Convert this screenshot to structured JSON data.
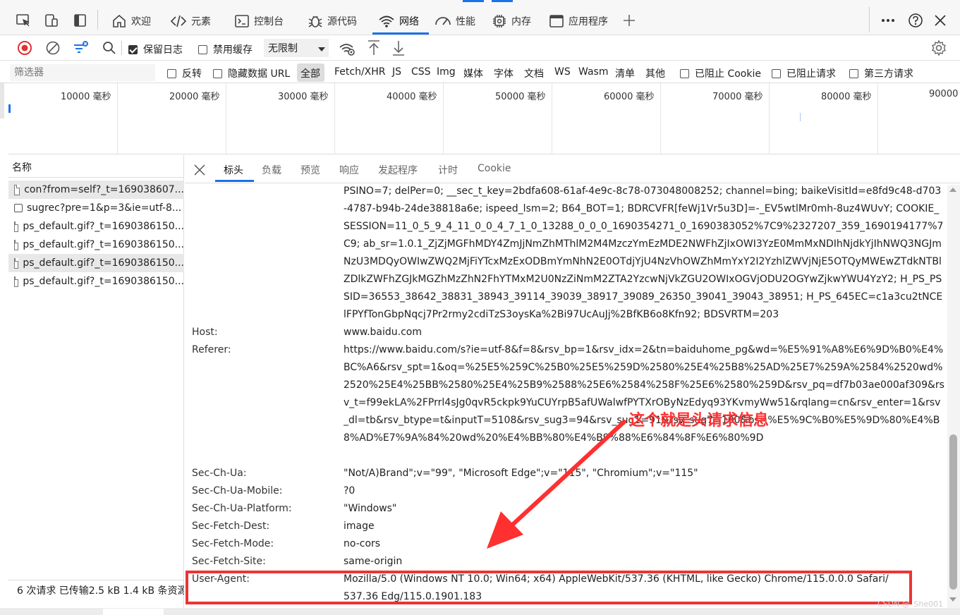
{
  "main_tabs": [
    {
      "label": "欢迎",
      "icon": "home-icon"
    },
    {
      "label": "元素",
      "icon": "code-icon"
    },
    {
      "label": "控制台",
      "icon": "console-icon"
    },
    {
      "label": "源代码",
      "icon": "bug-icon"
    },
    {
      "label": "网络",
      "icon": "wifi-icon",
      "active": true
    },
    {
      "label": "性能",
      "icon": "gauge-icon"
    },
    {
      "label": "内存",
      "icon": "chip-icon"
    },
    {
      "label": "应用程序",
      "icon": "window-icon"
    }
  ],
  "toolbar": {
    "preserve_log": "保留日志",
    "disable_cache": "禁用缓存",
    "throttle": "无限制"
  },
  "filter": {
    "placeholder": "筛选器",
    "invert": "反转",
    "hide_data_urls": "隐藏数据 URL",
    "types": [
      "全部",
      "Fetch/XHR",
      "JS",
      "CSS",
      "Img",
      "媒体",
      "字体",
      "文档",
      "WS",
      "Wasm",
      "清单",
      "其他"
    ],
    "blocked_cookies": "已阻止 Cookie",
    "blocked_requests": "已阻止请求",
    "third_party": "第三方请求"
  },
  "timeline": {
    "ticks": [
      "10000 毫秒",
      "20000 毫秒",
      "30000 毫秒",
      "40000 毫秒",
      "50000 毫秒",
      "60000 毫秒",
      "70000 毫秒",
      "80000 毫秒",
      "90000"
    ]
  },
  "requests": {
    "header": "名称",
    "items": [
      "con?from=self?_t=169038607...",
      "sugrec?pre=1&p=3&ie=utf-8...",
      "ps_default.gif?_t=1690386150...",
      "ps_default.gif?_t=1690386150...",
      "ps_default.gif?_t=1690386150...",
      "ps_default.gif?_t=1690386150..."
    ],
    "status": "6 次请求  已传输2.5 kB  1.4 kB 条资源"
  },
  "detail_tabs": [
    "标头",
    "负载",
    "预览",
    "响应",
    "发起程序",
    "计时",
    "Cookie"
  ],
  "headers": {
    "cookie_cont": "PSINO=7; delPer=0; __sec_t_key=2bdfa608-61af-4e9c-8c78-073048008252; channel=bing; baikeVisitId=e8fd9c48-d703-4787-b94b-24de38818a6e; ispeed_lsm=2; B64_BOT=1; BDRCVFR[feWj1Vr5u3D]=-_EV5wtlMr0mh-8uz4WUvY; COOKIE_SESSION=11_0_5_9_4_11_0_0_4_7_1_0_13288_0_0_0_1690354271_0_1690383052%7C9%2327207_359_1690194177%7C9; ab_sr=1.0.1_ZjZjMGFhMDY4ZmJjNmZhMThlM2M4MzczYmEzMDE2NWFhZjIxOWI3YzE0MmMxNDIhNjdkYjIhNWQ3NGJmNzU3MDQyOWIwZWQ2MjFiYTcxMzExODBmYmNhN2E0OTdjYjU4NzVhOWZhMmYxY2I2YzhlZWVjNjE5OTQyMWEwZTdkNTBlZDlkZWFhZGJkMGZhMzZhN2FhYTMxM2U0NzZiNmM2ZTA2YzcwNjVkZGU2OWIxOGVjODU2OGYwZjkwYWU4YzY2; H_PS_PSSID=36553_38642_38831_38943_39114_39039_38917_39089_26350_39041_39043_38951; H_PS_645EC=c1a3cu2tNCElFPYfTonGbpNqcj7Pr2rmy2cdiTzS3oysKa%2Bi97UcAuJj%2BfKB6o8Kfn92; BDSVRTM=203",
    "rows": [
      {
        "key": "Host:",
        "value": "www.baidu.com"
      },
      {
        "key": "Referer:",
        "value": "https://www.baidu.com/s?ie=utf-8&f=8&rsv_bp=1&rsv_idx=2&tn=baiduhome_pg&wd=%E5%91%A8%E6%9D%B0%E4%BC%A6&rsv_spt=1&oq=%25E5%259C%25B0%25E5%259D%2580%25E4%25B8%25AD%25E7%259A%2584%2520wd%2520%25E4%25BB%2580%25E4%25B9%2588%25E6%2584%258F%25E6%2580%259D&rsv_pq=df7b03ae000af309&rsv_t=f99ekLA%2FPrrl4sJg0qvR5ckpk9YuCUYrpB5afUWalwfPYTXrOByNzEdyq93YKvmyWw51&rqlang=cn&rsv_enter=1&rsv_dl=tb&rsv_btype=t&inputT=5108&rsv_sug3=94&rsv_sug1=91&rsv_sug7=100&bs=%E5%9C%B0%E5%9D%80%E4%B8%AD%E7%9A%84%20wd%20%E4%BB%80%E4%B9%88%E6%84%8F%E6%80%9D"
      },
      {
        "key": "Sec-Ch-Ua:",
        "value": "\"Not/A)Brand\";v=\"99\", \"Microsoft Edge\";v=\"115\", \"Chromium\";v=\"115\""
      },
      {
        "key": "Sec-Ch-Ua-Mobile:",
        "value": "?0"
      },
      {
        "key": "Sec-Ch-Ua-Platform:",
        "value": "\"Windows\""
      },
      {
        "key": "Sec-Fetch-Dest:",
        "value": "image"
      },
      {
        "key": "Sec-Fetch-Mode:",
        "value": "no-cors"
      },
      {
        "key": "Sec-Fetch-Site:",
        "value": "same-origin"
      },
      {
        "key": "User-Agent:",
        "value": "Mozilla/5.0 (Windows NT 10.0; Win64; x64) AppleWebKit/537.36 (KHTML, like Gecko) Chrome/115.0.0.0 Safari/537.36 Edg/115.0.1901.183"
      }
    ]
  },
  "annotation": "这个就是头请求信息",
  "watermark": "CSDN @_She001",
  "colors": {
    "accent": "#1a73e8",
    "annotation": "#ff3030",
    "record": "#e03131"
  }
}
